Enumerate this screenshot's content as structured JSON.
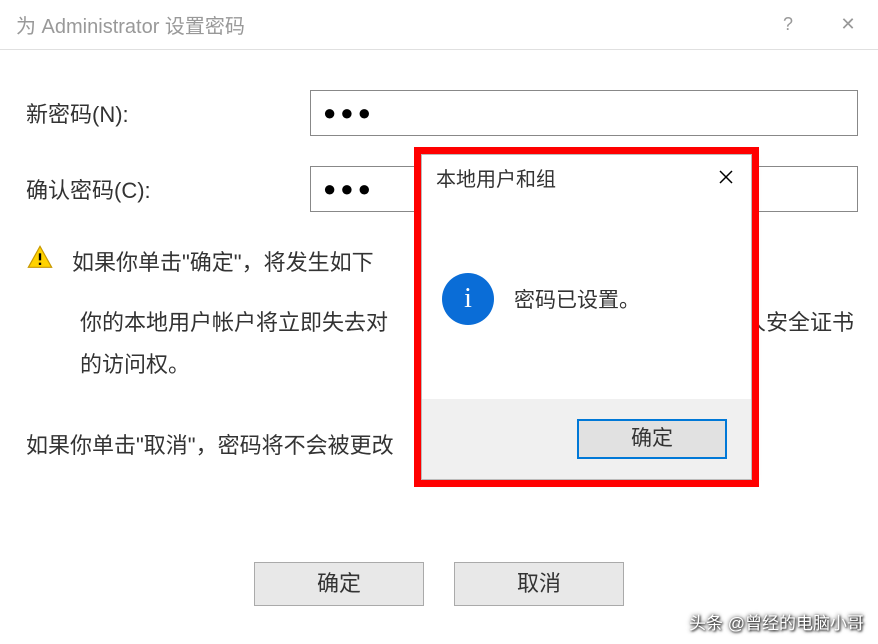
{
  "window": {
    "title": "为 Administrator 设置密码",
    "help_glyph": "?",
    "close_glyph": "✕"
  },
  "fields": {
    "new_password_label": "新密码(N):",
    "new_password_value": "●●●",
    "confirm_password_label": "确认密码(C):",
    "confirm_password_value": "●●●"
  },
  "warning": {
    "line1": "如果你单击\"确定\"，将发生如下",
    "line2a": "你的本地用户帐户将立即失去对",
    "line2b_tail": "码和个人安全证书的访问权。"
  },
  "cancel_line": "如果你单击\"取消\"，密码将不会被更改",
  "buttons": {
    "ok": "确定",
    "cancel": "取消"
  },
  "msgbox": {
    "title": "本地用户和组",
    "close_glyph": "✕",
    "info_glyph": "i",
    "message": "密码已设置。",
    "ok": "确定"
  },
  "watermark": "头条 @曾经的电脑小哥"
}
